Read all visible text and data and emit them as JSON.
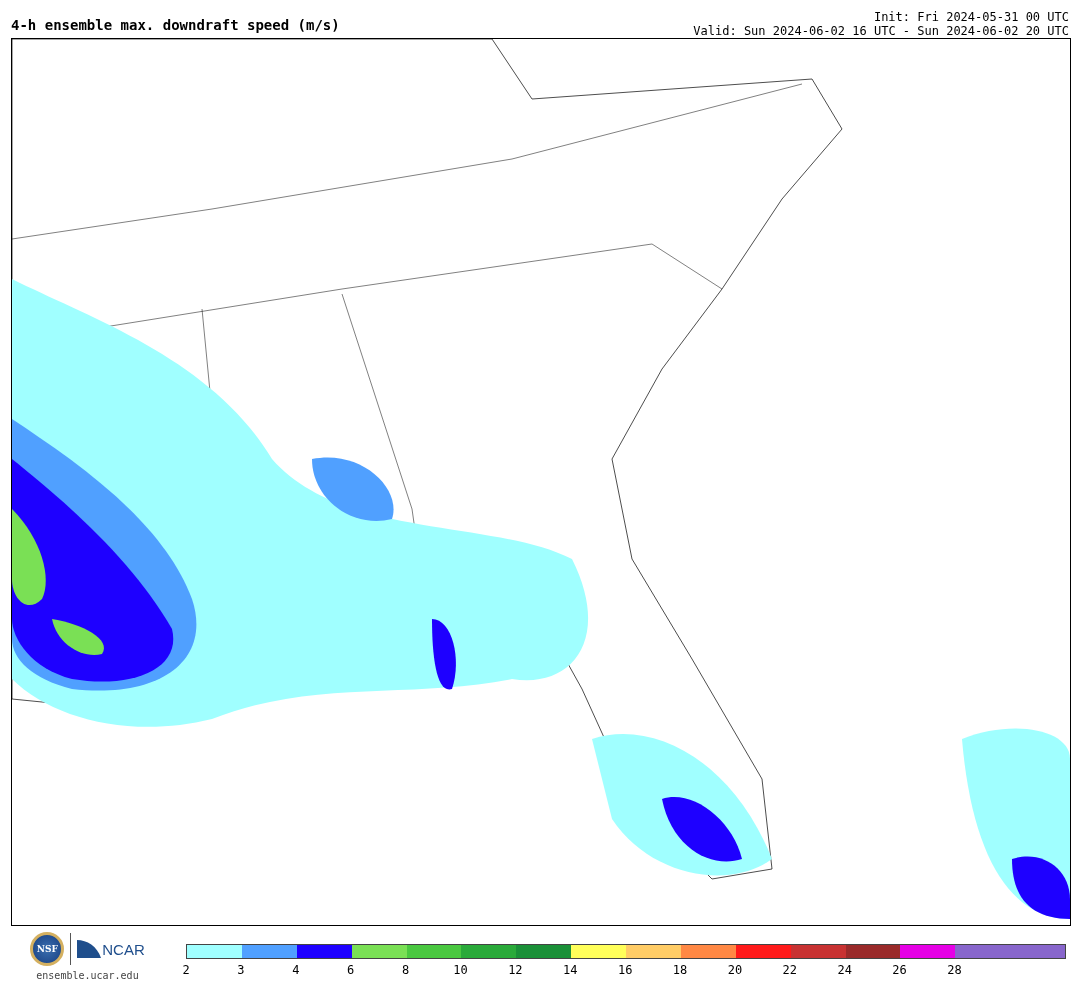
{
  "header": {
    "title": "4-h ensemble max. downdraft speed (m/s)",
    "init": "Init: Fri 2024-05-31 00 UTC",
    "valid": "Valid: Sun 2024-06-02 16 UTC - Sun 2024-06-02 20 UTC"
  },
  "footer": {
    "seal_text": "NSF",
    "org_text": "NCAR",
    "website": "ensemble.ucar.edu"
  },
  "colorbar": {
    "bins": [
      {
        "color": "#a0ffff",
        "label": "2"
      },
      {
        "color": "#50a0ff",
        "label": "3"
      },
      {
        "color": "#1e00ff",
        "label": "4"
      },
      {
        "color": "#7ae055",
        "label": "6"
      },
      {
        "color": "#4ac840",
        "label": "8"
      },
      {
        "color": "#2aaa3a",
        "label": "10"
      },
      {
        "color": "#1a9038",
        "label": "12"
      },
      {
        "color": "#ffff5a",
        "label": "14"
      },
      {
        "color": "#ffcc66",
        "label": "16"
      },
      {
        "color": "#ff8844",
        "label": "18"
      },
      {
        "color": "#ff1a1a",
        "label": "20"
      },
      {
        "color": "#c83232",
        "label": "22"
      },
      {
        "color": "#9a2a2a",
        "label": "24"
      },
      {
        "color": "#e600e6",
        "label": "26"
      },
      {
        "color": "#8866cc",
        "label": "28"
      },
      {
        "color": "#8866cc"
      }
    ]
  }
}
